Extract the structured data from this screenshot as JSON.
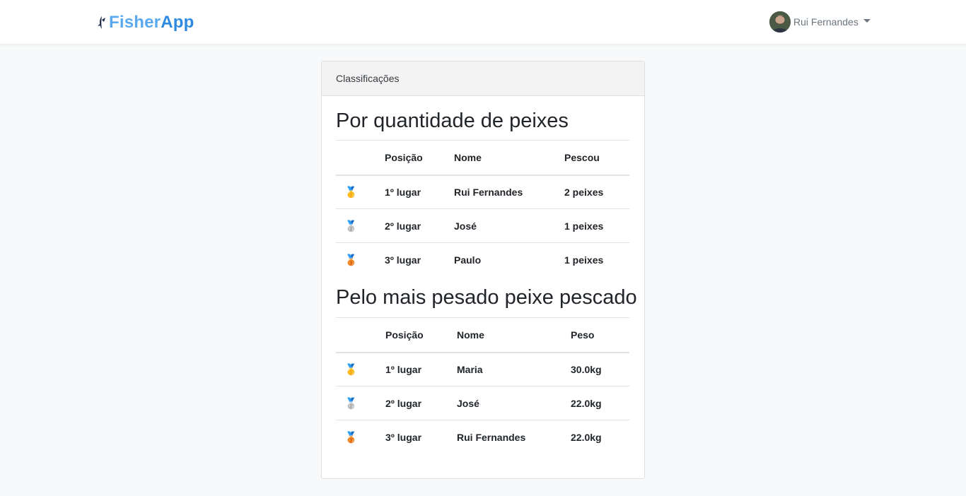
{
  "navbar": {
    "brand_part1": "Fisher",
    "brand_part2": "App",
    "user_name": "Rui Fernandes"
  },
  "card": {
    "header": "Classificações",
    "by_count": {
      "title": "Por quantidade de peixes",
      "columns": [
        "",
        "Posição",
        "Nome",
        "Pescou"
      ],
      "rows": [
        {
          "medal": "🥇",
          "position": "1º lugar",
          "name": "Rui Fernandes",
          "value": "2 peixes"
        },
        {
          "medal": "🥈",
          "position": "2º lugar",
          "name": "José",
          "value": "1 peixes"
        },
        {
          "medal": "🥉",
          "position": "3º lugar",
          "name": "Paulo",
          "value": "1 peixes"
        }
      ]
    },
    "by_weight": {
      "title": "Pelo mais pesado peixe pescado",
      "columns": [
        "",
        "Posição",
        "Nome",
        "Peso"
      ],
      "rows": [
        {
          "medal": "🥇",
          "position": "1º lugar",
          "name": "Maria",
          "value": "30.0kg"
        },
        {
          "medal": "🥈",
          "position": "2º lugar",
          "name": "José",
          "value": "22.0kg"
        },
        {
          "medal": "🥉",
          "position": "3º lugar",
          "name": "Rui Fernandes",
          "value": "22.0kg"
        }
      ]
    }
  },
  "colors": {
    "brand_light": "#5aa9ee",
    "brand_dark": "#2e8ae0",
    "page_bg": "#f8f9fa"
  },
  "icons": [
    "fish-icon",
    "user-avatar",
    "caret-down-icon",
    "gold-medal-icon",
    "silver-medal-icon",
    "bronze-medal-icon"
  ]
}
